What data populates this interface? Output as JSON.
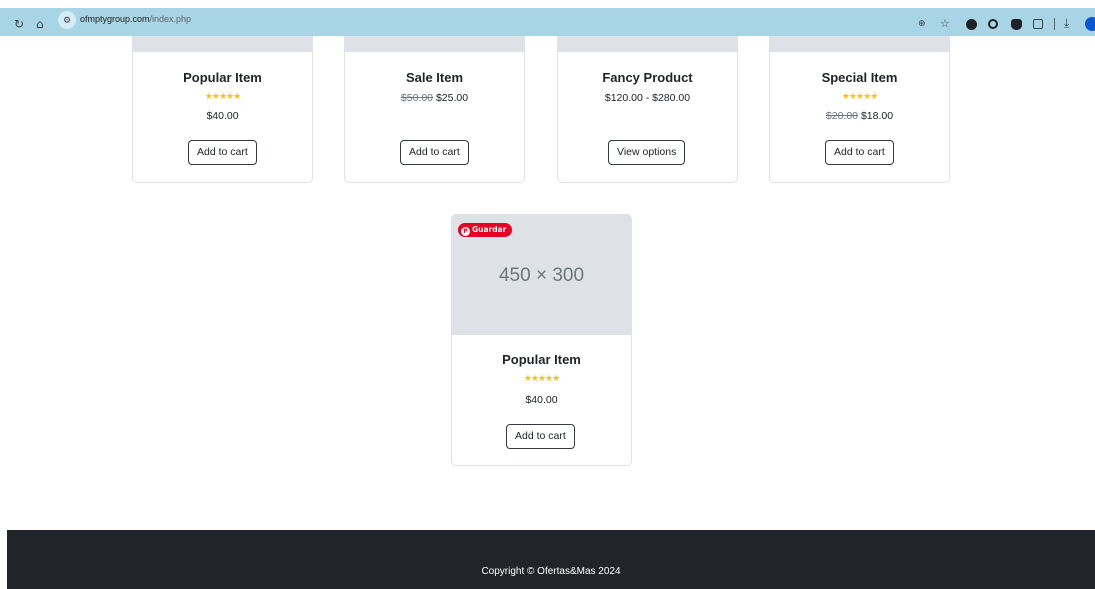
{
  "browser": {
    "url_host": "ofmptygroup.com",
    "url_path": "/index.php",
    "icons": [
      "reload-icon",
      "home-icon",
      "site-info-icon",
      "zoom-icon",
      "star-icon",
      "download-icon"
    ]
  },
  "products": [
    {
      "title": "Popular Item",
      "stars": "★★★★★",
      "old_price": "",
      "price": "$40.00",
      "button": "Add to cart"
    },
    {
      "title": "Sale Item",
      "stars": "",
      "old_price": "$50.00",
      "price": "$25.00",
      "button": "Add to cart"
    },
    {
      "title": "Fancy Product",
      "stars": "",
      "old_price": "",
      "price": "$120.00 - $280.00",
      "button": "View options"
    },
    {
      "title": "Special Item",
      "stars": "★★★★★",
      "old_price": "$20.00",
      "price": "$18.00",
      "button": "Add to cart"
    }
  ],
  "featured": {
    "image_label": "450 × 300",
    "pin_label": "Guardar",
    "title": "Popular Item",
    "stars": "★★★★★",
    "price": "$40.00",
    "button": "Add to cart"
  },
  "footer": {
    "copyright": "Copyright © Ofertas&Mas 2024"
  },
  "colors": {
    "star": "#ffc107",
    "footer_bg": "#212529",
    "pin": "#e60023",
    "chrome": "#a8d5e5"
  }
}
